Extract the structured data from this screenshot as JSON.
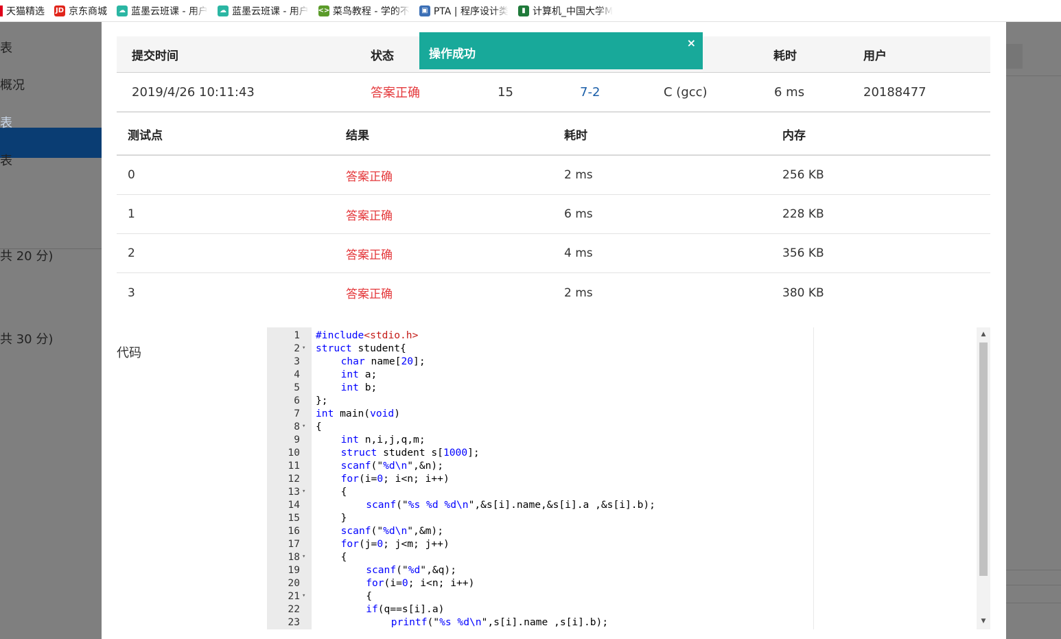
{
  "bookmarks": [
    {
      "label": "天猫精选",
      "icon": "tmall-icon",
      "color": "#e0001b"
    },
    {
      "label": "京东商城",
      "icon": "jd-icon",
      "color": "#e1251b"
    },
    {
      "label": "蓝墨云班课 - 用户",
      "icon": "mosoteach-icon",
      "color": "#2bb6a3"
    },
    {
      "label": "蓝墨云班课 - 用户",
      "icon": "mosoteach-icon",
      "color": "#2bb6a3"
    },
    {
      "label": "菜鸟教程 - 学的不",
      "icon": "runoob-icon",
      "color": "#5b9b2a"
    },
    {
      "label": "PTA | 程序设计类",
      "icon": "pta-icon",
      "color": "#3b6fb6"
    },
    {
      "label": "计算机_中国大学M",
      "icon": "mooc-icon",
      "color": "#1f7a3a"
    }
  ],
  "sidebar": {
    "items": [
      "表",
      "概况",
      "表",
      "表"
    ],
    "scores": [
      "共 20 分)",
      "共 30 分)"
    ]
  },
  "submission": {
    "headers": {
      "time": "提交时间",
      "status": "状态",
      "score": "",
      "problem": "",
      "compiler": "",
      "elapsed": "耗时",
      "user": "用户"
    },
    "row": {
      "time": "2019/4/26 10:11:43",
      "status": "答案正确",
      "score": "15",
      "problem": "7-2",
      "compiler": "C (gcc)",
      "elapsed": "6 ms",
      "user": "20188477"
    }
  },
  "testcases": {
    "headers": {
      "case": "测试点",
      "result": "结果",
      "elapsed": "耗时",
      "memory": "内存"
    },
    "rows": [
      {
        "case": "0",
        "result": "答案正确",
        "elapsed": "2 ms",
        "memory": "256 KB"
      },
      {
        "case": "1",
        "result": "答案正确",
        "elapsed": "6 ms",
        "memory": "228 KB"
      },
      {
        "case": "2",
        "result": "答案正确",
        "elapsed": "4 ms",
        "memory": "356 KB"
      },
      {
        "case": "3",
        "result": "答案正确",
        "elapsed": "2 ms",
        "memory": "380 KB"
      }
    ]
  },
  "code_label": "代码",
  "code": [
    {
      "n": "1",
      "indent": 0,
      "fold": false,
      "text": "#include<stdio.h>"
    },
    {
      "n": "2",
      "indent": 0,
      "fold": true,
      "text": "struct student{"
    },
    {
      "n": "3",
      "indent": 1,
      "fold": false,
      "text": "char name[20];"
    },
    {
      "n": "4",
      "indent": 1,
      "fold": false,
      "text": "int a;"
    },
    {
      "n": "5",
      "indent": 1,
      "fold": false,
      "text": "int b;"
    },
    {
      "n": "6",
      "indent": 0,
      "fold": false,
      "text": "};"
    },
    {
      "n": "7",
      "indent": 0,
      "fold": false,
      "text": "int main(void)"
    },
    {
      "n": "8",
      "indent": 0,
      "fold": true,
      "text": "{"
    },
    {
      "n": "9",
      "indent": 1,
      "fold": false,
      "text": "int n,i,j,q,m;"
    },
    {
      "n": "10",
      "indent": 1,
      "fold": false,
      "text": "struct student s[1000];"
    },
    {
      "n": "11",
      "indent": 1,
      "fold": false,
      "text": "scanf(\"%d\\n\",&n);"
    },
    {
      "n": "12",
      "indent": 1,
      "fold": false,
      "text": "for(i=0; i<n; i++)"
    },
    {
      "n": "13",
      "indent": 1,
      "fold": true,
      "text": "{"
    },
    {
      "n": "14",
      "indent": 2,
      "fold": false,
      "text": "scanf(\"%s %d %d\\n\",&s[i].name,&s[i].a ,&s[i].b);"
    },
    {
      "n": "15",
      "indent": 1,
      "fold": false,
      "text": "}"
    },
    {
      "n": "16",
      "indent": 1,
      "fold": false,
      "text": "scanf(\"%d\\n\",&m);"
    },
    {
      "n": "17",
      "indent": 1,
      "fold": false,
      "text": "for(j=0; j<m; j++)"
    },
    {
      "n": "18",
      "indent": 1,
      "fold": true,
      "text": "{"
    },
    {
      "n": "19",
      "indent": 2,
      "fold": false,
      "text": "scanf(\"%d\",&q);"
    },
    {
      "n": "20",
      "indent": 2,
      "fold": false,
      "text": "for(i=0; i<n; i++)"
    },
    {
      "n": "21",
      "indent": 2,
      "fold": true,
      "text": "{"
    },
    {
      "n": "22",
      "indent": 2,
      "fold": false,
      "text": "if(q==s[i].a)"
    },
    {
      "n": "23",
      "indent": 3,
      "fold": false,
      "text": "printf(\"%s %d\\n\",s[i].name ,s[i].b);"
    }
  ],
  "toast": {
    "message": "操作成功",
    "close": "×",
    "color": "#18a99a"
  },
  "colors": {
    "error": "#e4393c",
    "link": "#1a5ea8",
    "sidebar_active": "#0a3d73"
  }
}
